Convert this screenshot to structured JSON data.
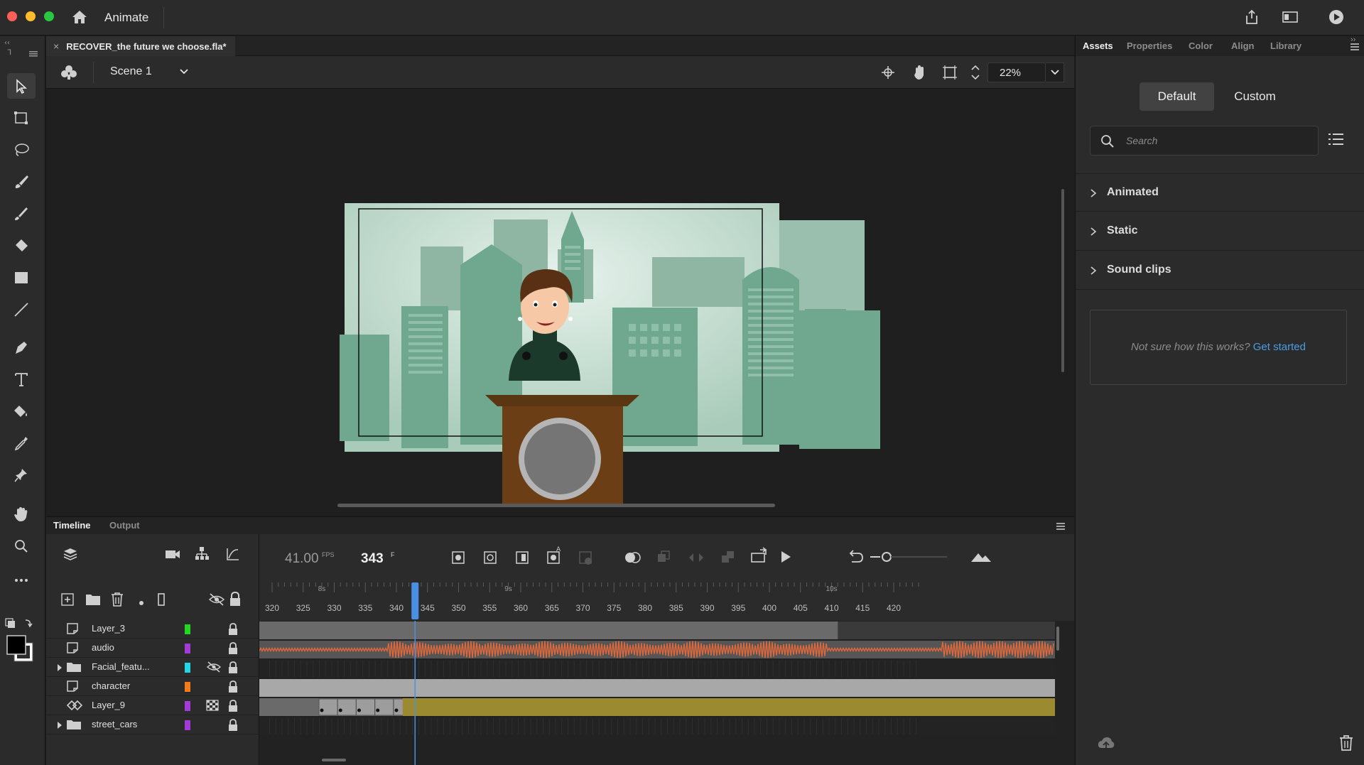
{
  "window": {
    "app_name": "Animate"
  },
  "document": {
    "tab_title": "RECOVER_the future we choose.fla*",
    "tab_close": "×"
  },
  "scene": {
    "name": "Scene 1"
  },
  "zoom": {
    "value": "22%"
  },
  "timeline": {
    "tabs": [
      "Timeline",
      "Output"
    ],
    "fps_value": "41.00",
    "fps_unit": "FPS",
    "frame_value": "343",
    "frame_unit": "F",
    "time_markers": [
      "8s",
      "9s",
      "10s"
    ],
    "frame_numbers": [
      "320",
      "325",
      "330",
      "335",
      "340",
      "345",
      "350",
      "355",
      "360",
      "365",
      "370",
      "375",
      "380",
      "385",
      "390",
      "395",
      "400",
      "405",
      "410",
      "415",
      "420"
    ],
    "playhead_frame": 343,
    "layers": [
      {
        "name": "Layer_3",
        "color": "#22d622",
        "type": "layer"
      },
      {
        "name": "audio",
        "color": "#a33bd6",
        "type": "layer"
      },
      {
        "name": "Facial_featu...",
        "color": "#22d6e6",
        "type": "folder",
        "hidden": true
      },
      {
        "name": "character",
        "color": "#f07c1a",
        "type": "layer"
      },
      {
        "name": "Layer_9",
        "color": "#a33bd6",
        "type": "motion"
      },
      {
        "name": "street_cars",
        "color": "#a33bd6",
        "type": "folder"
      }
    ]
  },
  "right_panel": {
    "tabs": [
      "Assets",
      "Properties",
      "Color",
      "Align",
      "Library"
    ],
    "active_tab": "Assets",
    "segment_default": "Default",
    "segment_custom": "Custom",
    "search_placeholder": "Search",
    "sections": [
      "Animated",
      "Static",
      "Sound clips"
    ],
    "help_text": "Not sure how this works?",
    "help_link": "Get started"
  },
  "colors": {
    "accent": "#4a9de6",
    "stage_bg": "#b9d7c8",
    "building": "#6fa88e",
    "waveform": "#e0683a",
    "tween": "#9b8a2f",
    "playhead": "#4a90e2"
  }
}
